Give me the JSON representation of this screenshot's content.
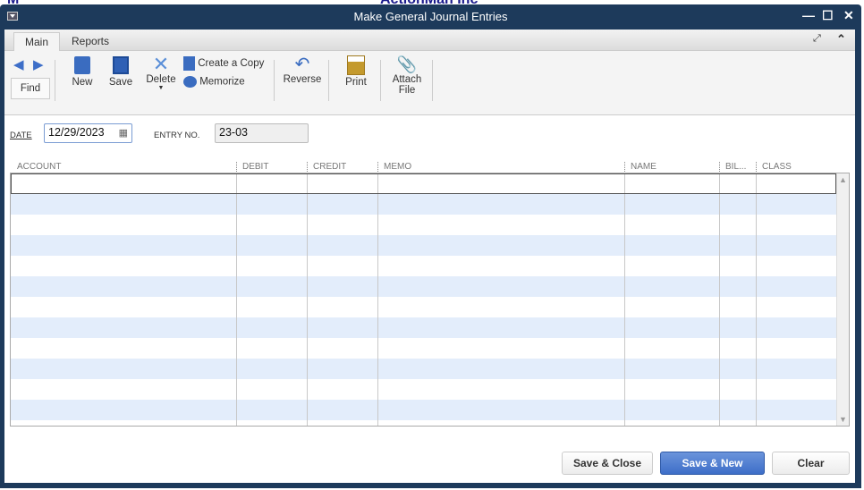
{
  "background": {
    "left_text": "M",
    "company": "ActionMan Inc"
  },
  "window": {
    "title": "Make General Journal Entries",
    "minimize": "—",
    "maximize": "☐",
    "close": "✕"
  },
  "tabs": [
    {
      "label": "Main",
      "active": true
    },
    {
      "label": "Reports",
      "active": false
    }
  ],
  "toolbar": {
    "find": "Find",
    "new": "New",
    "save": "Save",
    "delete": "Delete",
    "create_copy": "Create a Copy",
    "memorize": "Memorize",
    "reverse": "Reverse",
    "print": "Print",
    "attach_line1": "Attach",
    "attach_line2": "File"
  },
  "form": {
    "date_label": "DATE",
    "date_value": "12/29/2023",
    "entry_label": "ENTRY NO.",
    "entry_value": "23-03"
  },
  "grid": {
    "columns": [
      "ACCOUNT",
      "DEBIT",
      "CREDIT",
      "MEMO",
      "NAME",
      "BIL...",
      "CLASS"
    ],
    "rows": []
  },
  "buttons": {
    "save_close": "Save & Close",
    "save_new": "Save & New",
    "clear": "Clear"
  },
  "colors": {
    "frame": "#1d3a5b",
    "accent": "#3d6ec8",
    "row_alt": "#e3edfb"
  }
}
